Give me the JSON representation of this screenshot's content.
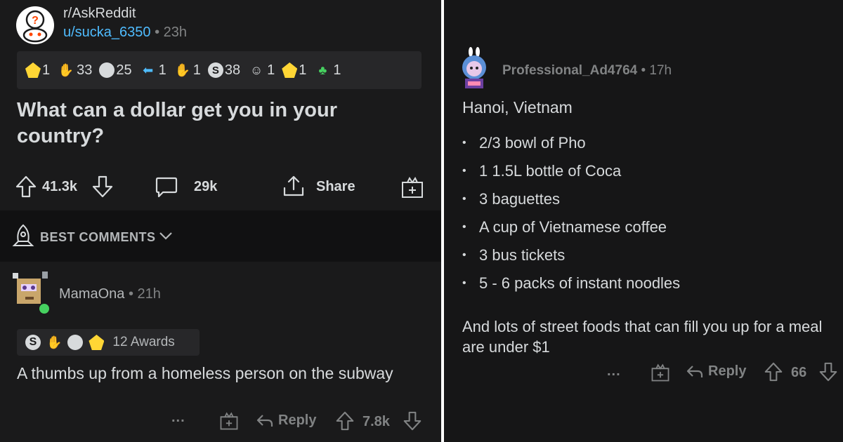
{
  "post": {
    "subreddit": "r/AskReddit",
    "author": "u/sucka_6350",
    "time": "23h",
    "awards": [
      {
        "icon": "gold-trophy-icon",
        "count": "1"
      },
      {
        "icon": "hands-icon",
        "count": "33"
      },
      {
        "icon": "face-icon",
        "count": "25"
      },
      {
        "icon": "arrow-icon",
        "count": "1"
      },
      {
        "icon": "hands-gold-icon",
        "count": "1"
      },
      {
        "icon": "silver-s-icon",
        "count": "38"
      },
      {
        "icon": "snoo-icon",
        "count": "1"
      },
      {
        "icon": "gold-badge-icon",
        "count": "1"
      },
      {
        "icon": "dino-icon",
        "count": "1"
      }
    ],
    "title": "What can a dollar get you in your country?",
    "score": "41.3k",
    "comments": "29k",
    "share_label": "Share"
  },
  "sort": {
    "label": "BEST COMMENTS"
  },
  "comment1": {
    "author": "MamaOna",
    "time": "21h",
    "awards_label": "12 Awards",
    "body": "A thumbs up from a homeless person on the subway",
    "more": "...",
    "reply_label": "Reply",
    "score": "7.8k"
  },
  "comment2": {
    "author": "Professional_Ad4764",
    "time": "17h",
    "heading": "Hanoi, Vietnam",
    "items": [
      "2/3 bowl of Pho",
      "1 1.5L bottle of Coca",
      "3 baguettes",
      "A cup of Vietnamese coffee",
      "3 bus tickets",
      "5 - 6 packs of instant noodles"
    ],
    "footer": "And lots of street foods that can fill you up for a meal are under $1",
    "more": "...",
    "reply_label": "Reply",
    "score": "66"
  },
  "colors": {
    "bg": "#1a1a1b",
    "text": "#d7dadc",
    "muted": "#818384",
    "link": "#4fbcff"
  }
}
